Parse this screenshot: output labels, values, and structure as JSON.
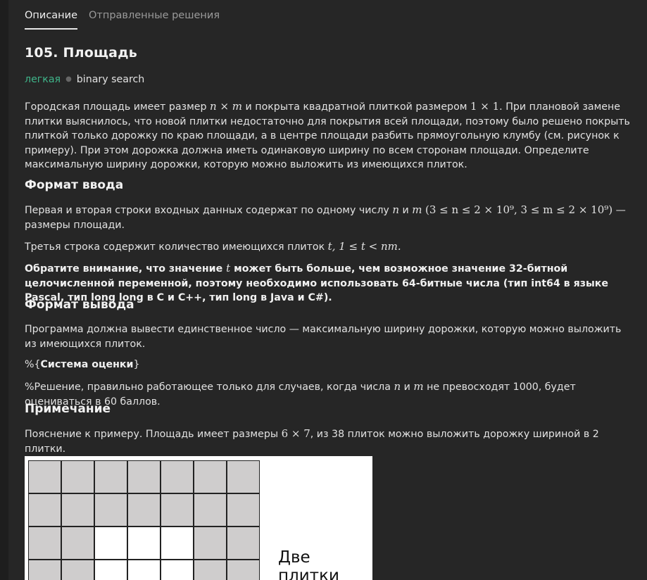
{
  "tabs": [
    {
      "label": "Описание",
      "active": true
    },
    {
      "label": "Отправленные решения",
      "active": false
    }
  ],
  "problem": {
    "title": "105. Площадь",
    "difficulty": "легкая",
    "tag": "binary search"
  },
  "statement": {
    "p1a": "Городская площадь имеет размер ",
    "p1_nm": "n × m",
    "p1b": " и покрыта квадратной плиткой размером ",
    "p1_11": "1 × 1",
    "p1c": ". При плановой замене плитки выяснилось, что новой плитки недостаточно для покрытия всей площади, поэтому было решено покрыть плиткой только дорожку по краю площади, а в центре площади разбить прямоугольную клумбу (см. рисунок к примеру). При этом дорожка должна иметь одинаковую ширину по всем сторонам площади. Определите максимальную ширину дорожки, которую можно выложить из имеющихся плиток."
  },
  "input_format": {
    "heading": "Формат ввода",
    "p1a": "Первая и вторая строки входных данных содержат по одному числу ",
    "p1_n": "n",
    "p1_and": " и ",
    "p1_m": "m",
    "p1_constraint": "(3 ≤ n ≤ 2 × 10⁹, 3 ≤ m ≤ 2 × 10⁹)",
    "p1b": " — размеры площади.",
    "p2a": "Третья строка содержит количество имеющихся плиток ",
    "p2_math": "t, 1 ≤ t < nm.",
    "p3a": "Обратите внимание, что значение ",
    "p3_t": "t",
    "p3b": " может быть больше, чем возможное значение 32-битной целочисленной переменной, поэтому необходимо использовать 64-битные числа (тип int64 в языке Pascal, тип long long в C и C++, тип long в Java и C#)."
  },
  "output_format": {
    "heading": "Формат вывода",
    "p1": "Программа должна вывести единственное число — максимальную ширину дорожки, которую можно выложить из имеющихся плиток.",
    "grading_prefix": "%{",
    "grading_bold": "Система оценки",
    "grading_suffix": "}",
    "p3a": "%Решение, правильно работающее только для случаев, когда числа ",
    "p3_n": "n",
    "p3_and": " и ",
    "p3_m": "m",
    "p3b": " не превосходят 1000, будет оцениваться в 60 баллов."
  },
  "note": {
    "heading": "Примечание",
    "p1a": "Пояснение к примеру. Площадь имеет размеры ",
    "p1_math": "6 × 7",
    "p1b": ", из 38 плиток можно выложить дорожку шириной в 2 плитки."
  },
  "figure": {
    "label": "Две плитки",
    "rows": [
      [
        "g",
        "g",
        "g",
        "g",
        "g",
        "g",
        "g"
      ],
      [
        "g",
        "g",
        "g",
        "g",
        "g",
        "g",
        "g"
      ],
      [
        "g",
        "g",
        "w",
        "w",
        "w",
        "g",
        "g"
      ],
      [
        "g",
        "g",
        "w",
        "w",
        "w",
        "g",
        "g"
      ]
    ]
  },
  "colors": {
    "difficulty": "#3fb58a",
    "background": "#262626",
    "tile_gray": "#cfcdcd"
  }
}
